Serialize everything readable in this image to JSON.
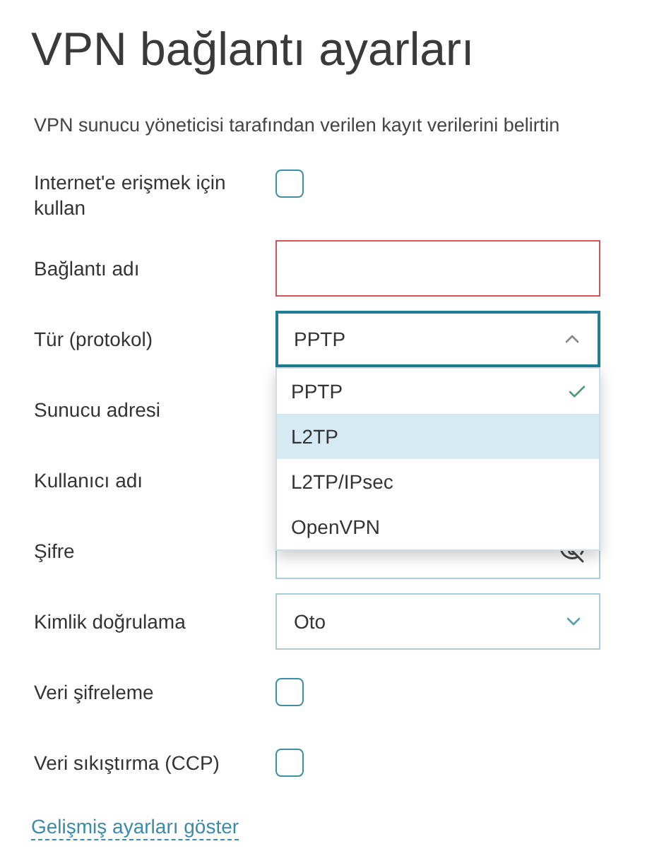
{
  "title": "VPN bağlantı ayarları",
  "subtitle": "VPN sunucu yöneticisi tarafından verilen kayıt verilerini belirtin",
  "fields": [
    {
      "kind": "checkbox",
      "label": "Internet'e erişmek için kullan",
      "checked": false
    },
    {
      "kind": "text",
      "label": "Bağlantı adı",
      "invalid": true
    },
    {
      "kind": "select",
      "label": "Tür (protokol)",
      "value": "PPTP",
      "expanded": true,
      "options": [
        {
          "label": "PPTP",
          "selected": true,
          "highlighted": false
        },
        {
          "label": "L2TP",
          "selected": false,
          "highlighted": true
        },
        {
          "label": "L2TP/IPsec",
          "selected": false,
          "highlighted": false
        },
        {
          "label": "OpenVPN",
          "selected": false,
          "highlighted": false
        }
      ]
    },
    {
      "kind": "covered",
      "label": "Sunucu adresi"
    },
    {
      "kind": "covered",
      "label": "Kullanıcı adı"
    },
    {
      "kind": "password",
      "label": "Şifre"
    },
    {
      "kind": "select",
      "label": "Kimlik doğrulama",
      "value": "Oto",
      "expanded": false
    },
    {
      "kind": "checkbox",
      "label": "Veri şifreleme",
      "checked": false
    },
    {
      "kind": "checkbox",
      "label": "Veri sıkıştırma (CCP)",
      "checked": false
    }
  ],
  "link": "Gelişmiş ayarları göster"
}
